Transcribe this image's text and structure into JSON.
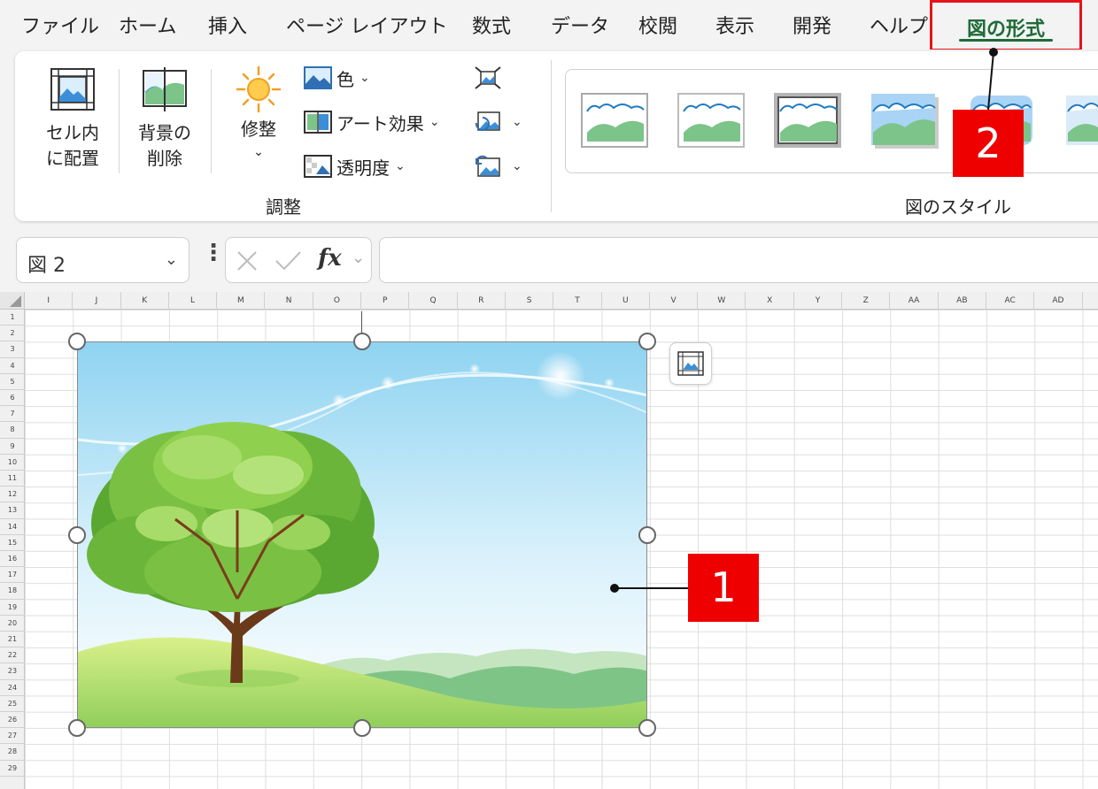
{
  "menu": {
    "items": [
      "ファイル",
      "ホーム",
      "挿入",
      "ページ レイアウト",
      "数式",
      "データ",
      "校閲",
      "表示",
      "開発",
      "ヘルプ"
    ],
    "active": "図の形式"
  },
  "ribbon": {
    "place_in_cell": "セル内\nに配置",
    "remove_background": "背景の\n削除",
    "corrections": "修整",
    "color": "色",
    "artistic_effects": "アート効果",
    "transparency": "透明度",
    "group_adjust": "調整",
    "group_picture_styles": "図のスタイル"
  },
  "formula_bar": {
    "name_box": "図 2",
    "dots": "⋮",
    "fx": "fx",
    "value": ""
  },
  "sheet": {
    "columns": [
      "I",
      "J",
      "K",
      "L",
      "M",
      "N",
      "O",
      "P",
      "Q",
      "R",
      "S",
      "T",
      "U",
      "V",
      "W",
      "X",
      "Y",
      "Z",
      "AA",
      "AB",
      "AC",
      "AD"
    ],
    "rows": [
      "1",
      "2",
      "3",
      "4",
      "5",
      "6",
      "7",
      "8",
      "9",
      "10",
      "11",
      "12",
      "13",
      "14",
      "15",
      "16",
      "17",
      "18",
      "19",
      "20",
      "21",
      "22",
      "23",
      "24",
      "25",
      "26",
      "27",
      "28",
      "29"
    ]
  },
  "callouts": {
    "picture": "1",
    "tab": "2"
  },
  "colors": {
    "accent_green": "#1e6b38",
    "callout_red": "#ef0000"
  }
}
